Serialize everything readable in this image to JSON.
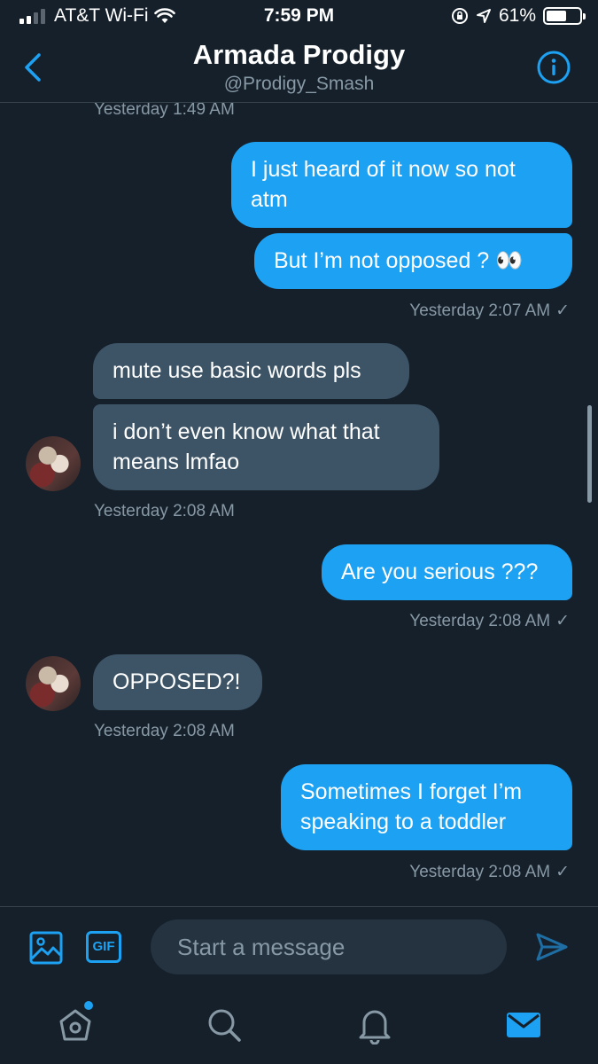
{
  "status_bar": {
    "carrier": "AT&T Wi-Fi",
    "time": "7:59 PM",
    "battery_percent": "61%",
    "battery_level": 0.61,
    "icons": [
      "signal-icon",
      "wifi-icon",
      "orientation-lock-icon",
      "location-icon",
      "battery-icon"
    ]
  },
  "header": {
    "title": "Armada Prodigy",
    "handle": "@Prodigy_Smash",
    "icons": [
      "back-chevron-icon",
      "info-icon"
    ]
  },
  "messages": [
    {
      "type": "timestamp",
      "side": "left",
      "text": "Yesterday 1:49 AM"
    },
    {
      "type": "bubble",
      "side": "out",
      "text_lines": [
        "I just heard of it now so not",
        "atm"
      ]
    },
    {
      "type": "bubble",
      "side": "out",
      "text": "But I’m not opposed ? 👀"
    },
    {
      "type": "timestamp",
      "side": "right",
      "text": "Yesterday 2:07 AM",
      "check": "✓"
    },
    {
      "type": "bubble",
      "side": "in",
      "text": "mute use basic words pls"
    },
    {
      "type": "bubble",
      "side": "in",
      "text_lines": [
        "i don’t even know what that",
        "means lmfao"
      ]
    },
    {
      "type": "timestamp",
      "side": "left",
      "text": "Yesterday 2:08 AM"
    },
    {
      "type": "bubble",
      "side": "out",
      "text": "Are you serious ???"
    },
    {
      "type": "timestamp",
      "side": "right",
      "text": "Yesterday 2:08 AM",
      "check": "✓"
    },
    {
      "type": "bubble",
      "side": "in",
      "text": "OPPOSED?!"
    },
    {
      "type": "timestamp",
      "side": "left",
      "text": "Yesterday 2:08 AM"
    },
    {
      "type": "bubble",
      "side": "out",
      "text_lines": [
        "Sometimes I forget I’m",
        "speaking to a toddler"
      ]
    },
    {
      "type": "timestamp",
      "side": "right",
      "text": "Yesterday 2:08 AM",
      "check": "✓"
    }
  ],
  "composer": {
    "placeholder": "Start a message",
    "gif_label": "GIF",
    "icons": [
      "image-icon",
      "gif-icon",
      "send-icon"
    ]
  },
  "tab_bar": {
    "icons": [
      "home-icon",
      "search-icon",
      "notifications-icon",
      "messages-icon"
    ],
    "active": "messages-icon"
  },
  "colors": {
    "background": "#15202b",
    "accent": "#1da1f2",
    "incoming_bubble": "#3d5466",
    "secondary_text": "#8899a6"
  }
}
